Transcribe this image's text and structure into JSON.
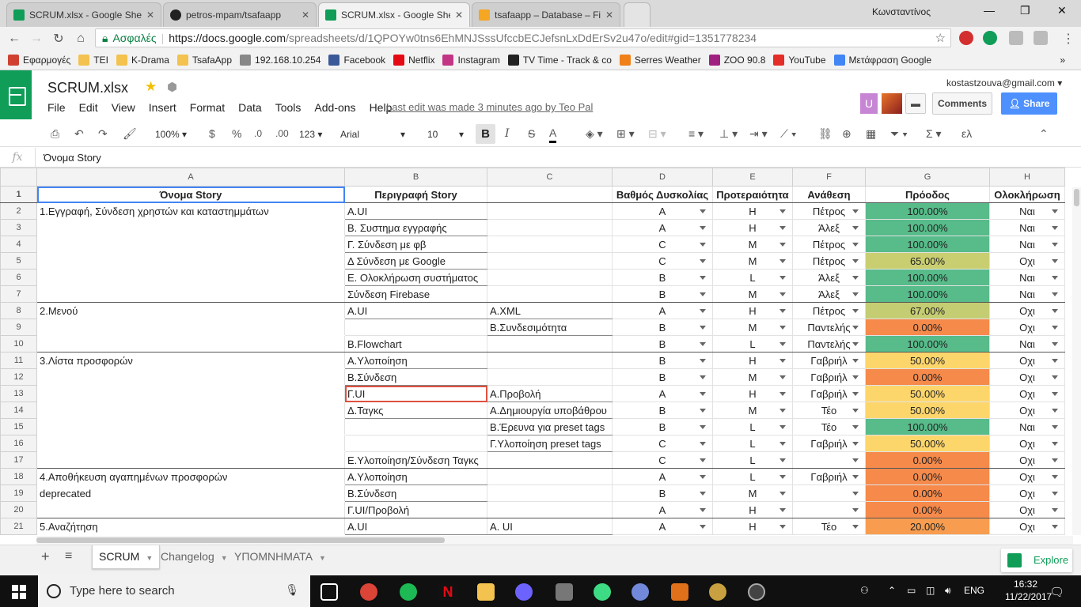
{
  "browser": {
    "tabs": [
      {
        "title": "SCRUM.xlsx - Google She",
        "color": "#0f9d58"
      },
      {
        "title": "petros-mpam/tsafaapp",
        "color": "#222222"
      },
      {
        "title": "SCRUM.xlsx - Google She",
        "color": "#0f9d58"
      },
      {
        "title": "tsafaapp – Database – Fir",
        "color": "#f5a623"
      }
    ],
    "window_user": "Κωνσταντίνος",
    "secure_label": "Ασφαλές",
    "url_host": "https://docs.google.com",
    "url_path": "/spreadsheets/d/1QPOYw0tns6EhMNJSssUfccbECJefsnLxDdErSv2u47o/edit#gid=1351778234",
    "ext_badge": "1",
    "bookmarks": [
      {
        "label": "Εφαρμογές",
        "icon": "apps-icon",
        "color": "#d04030"
      },
      {
        "label": "TEI",
        "icon": "folder-icon",
        "color": "#f3c24f"
      },
      {
        "label": "K-Drama",
        "icon": "folder-icon",
        "color": "#f3c24f"
      },
      {
        "label": "TsafaApp",
        "icon": "folder-icon",
        "color": "#f3c24f"
      },
      {
        "label": "192.168.10.254",
        "icon": "page-icon",
        "color": "#888888"
      },
      {
        "label": "Facebook",
        "icon": "facebook-icon",
        "color": "#3b5998"
      },
      {
        "label": "Netflix",
        "icon": "netflix-icon",
        "color": "#e50914"
      },
      {
        "label": "Instagram",
        "icon": "instagram-icon",
        "color": "#c13584"
      },
      {
        "label": "TV Time - Track & co",
        "icon": "tvtime-icon",
        "color": "#222222"
      },
      {
        "label": "Serres Weather",
        "icon": "weather-icon",
        "color": "#f0801a"
      },
      {
        "label": "ZOO 90.8",
        "icon": "radio-icon",
        "color": "#a02080"
      },
      {
        "label": "YouTube",
        "icon": "youtube-icon",
        "color": "#e52d27"
      },
      {
        "label": "Μετάφραση Google",
        "icon": "translate-icon",
        "color": "#4285f4"
      }
    ],
    "bookmarks_overflow": "»"
  },
  "doc": {
    "title": "SCRUM.xlsx",
    "menu": [
      "File",
      "Edit",
      "View",
      "Insert",
      "Format",
      "Data",
      "Tools",
      "Add-ons",
      "Help"
    ],
    "last_edit": "Last edit was made 3 minutes ago by Teo Pal",
    "email": "kostastzouva@gmail.com",
    "avatar_letter": "U",
    "comments_label": "Comments",
    "share_label": "Share"
  },
  "toolbar": {
    "zoom": "100%",
    "currency": "$",
    "percent": "%",
    "dec_less": ".0",
    "dec_more": ".00",
    "more_formats": "123",
    "font": "Arial",
    "font_size": "10",
    "bold": "B",
    "italic": "I",
    "strike": "S",
    "textcolor": "A",
    "input_tools": "ελ"
  },
  "formula": {
    "fx": "fx",
    "value": "Όνομα Story"
  },
  "sheet": {
    "columns": [
      "A",
      "B",
      "C",
      "D",
      "E",
      "F",
      "G",
      "H"
    ],
    "headers": [
      "Όνομα Story",
      "Περιγραφή Story",
      "",
      "Βαθμός Δυσκολίας",
      "Προτεραιότητα",
      "Ανάθεση",
      "Πρόοδος",
      "Ολοκλήρωση"
    ],
    "rows": [
      {
        "n": "2",
        "a": "1.Εγγραφή, Σύνδεση χρηστών και καταστημμάτων",
        "b": "A.UI",
        "c": "",
        "d": "A",
        "e": "H",
        "f": "Πέτρος",
        "g": "100.00%",
        "h": "Ναι",
        "color": "#57bb8a"
      },
      {
        "n": "3",
        "a": "",
        "b": "Β. Συστημα εγγραφής",
        "c": "",
        "d": "A",
        "e": "H",
        "f": "Άλεξ",
        "g": "100.00%",
        "h": "Ναι",
        "color": "#57bb8a"
      },
      {
        "n": "4",
        "a": "",
        "b": "Γ. Σύνδεση με φβ",
        "c": "",
        "d": "C",
        "e": "M",
        "f": "Πέτρος",
        "g": "100.00%",
        "h": "Ναι",
        "color": "#57bb8a"
      },
      {
        "n": "5",
        "a": "",
        "b": "Δ Σύνδεση με Google",
        "c": "",
        "d": "C",
        "e": "M",
        "f": "Πέτρος",
        "g": "65.00%",
        "h": "Οχι",
        "color": "#c9cf71"
      },
      {
        "n": "6",
        "a": "",
        "b": "Ε. Ολοκλήρωση συστήματος",
        "c": "",
        "d": "B",
        "e": "L",
        "f": "Άλεξ",
        "g": "100.00%",
        "h": "Ναι",
        "color": "#57bb8a"
      },
      {
        "n": "7",
        "a": "",
        "b": "Σύνδεση Firebase",
        "c": "",
        "d": "B",
        "e": "M",
        "f": "Άλεξ",
        "g": "100.00%",
        "h": "Ναι",
        "color": "#57bb8a"
      },
      {
        "n": "8",
        "a": "2.Μενού",
        "b": "A.UI",
        "c": "A.XML",
        "d": "A",
        "e": "H",
        "f": "Πέτρος",
        "g": "67.00%",
        "h": "Οχι",
        "color": "#c5cd72"
      },
      {
        "n": "9",
        "a": "",
        "b": "",
        "c": "B.Συνδεσιμότητα",
        "d": "B",
        "e": "M",
        "f": "Παντελής",
        "g": "0.00%",
        "h": "Οχι",
        "color": "#f58a4b"
      },
      {
        "n": "10",
        "a": "",
        "b": "B.Flowchart",
        "c": "",
        "d": "B",
        "e": "L",
        "f": "Παντελής",
        "g": "100.00%",
        "h": "Ναι",
        "color": "#57bb8a"
      },
      {
        "n": "11",
        "a": "3.Λίστα προσφορών",
        "b": "A.Υλοποίηση",
        "c": "",
        "d": "B",
        "e": "H",
        "f": "Γαβριήλ",
        "g": "50.00%",
        "h": "Οχι",
        "color": "#fdd66b"
      },
      {
        "n": "12",
        "a": "",
        "b": "B.Σύνδεση",
        "c": "",
        "d": "B",
        "e": "M",
        "f": "Γαβριήλ",
        "g": "0.00%",
        "h": "Οχι",
        "color": "#f58a4b"
      },
      {
        "n": "13",
        "a": "",
        "b": "Γ.UI",
        "c": "A.Προβολή",
        "d": "A",
        "e": "H",
        "f": "Γαβριήλ",
        "g": "50.00%",
        "h": "Οχι",
        "color": "#fdd66b"
      },
      {
        "n": "14",
        "a": "",
        "b": "Δ.Ταγκς",
        "c": "A.Δημιουργία υποβάθρου",
        "d": "B",
        "e": "M",
        "f": "Τέο",
        "g": "50.00%",
        "h": "Οχι",
        "color": "#fdd66b"
      },
      {
        "n": "15",
        "a": "",
        "b": "",
        "c": "B.Έρευνα για preset tags",
        "d": "B",
        "e": "L",
        "f": "Τέο",
        "g": "100.00%",
        "h": "Ναι",
        "color": "#57bb8a"
      },
      {
        "n": "16",
        "a": "",
        "b": "",
        "c": "Γ.Υλοποίηση preset tags",
        "d": "C",
        "e": "L",
        "f": "Γαβριήλ",
        "g": "50.00%",
        "h": "Οχι",
        "color": "#fdd66b"
      },
      {
        "n": "17",
        "a": "",
        "b": "E.Υλοποίηση/Σύνδεση Ταγκς",
        "c": "",
        "d": "C",
        "e": "L",
        "f": "",
        "g": "0.00%",
        "h": "Οχι",
        "color": "#f58a4b"
      },
      {
        "n": "18",
        "a": "4.Αποθήκευση αγαπημένων προσφορών",
        "b": "A.Υλοποίηση",
        "c": "",
        "d": "A",
        "e": "L",
        "f": "Γαβριήλ",
        "g": "0.00%",
        "h": "Οχι",
        "color": "#f58a4b"
      },
      {
        "n": "19",
        "a": "deprecated",
        "b": "B.Σύνδεση",
        "c": "",
        "d": "B",
        "e": "M",
        "f": "",
        "g": "0.00%",
        "h": "Οχι",
        "color": "#f58a4b"
      },
      {
        "n": "20",
        "a": "",
        "b": "Γ.UI/Προβολή",
        "c": "",
        "d": "A",
        "e": "H",
        "f": "",
        "g": "0.00%",
        "h": "Οχι",
        "color": "#f58a4b"
      },
      {
        "n": "21",
        "a": "5.Αναζήτηση",
        "b": "A.UI",
        "c": "A. UI",
        "d": "A",
        "e": "H",
        "f": "Τέο",
        "g": "20.00%",
        "h": "Οχι",
        "color": "#f89d4f"
      }
    ],
    "tabs": [
      "SCRUM",
      "Changelog",
      "ΥΠΟΜΝΗΜΑΤΑ"
    ],
    "explore_label": "Explore"
  },
  "taskbar": {
    "search_placeholder": "Type here to search",
    "lang": "ENG",
    "time": "16:32",
    "date": "11/22/2017"
  }
}
